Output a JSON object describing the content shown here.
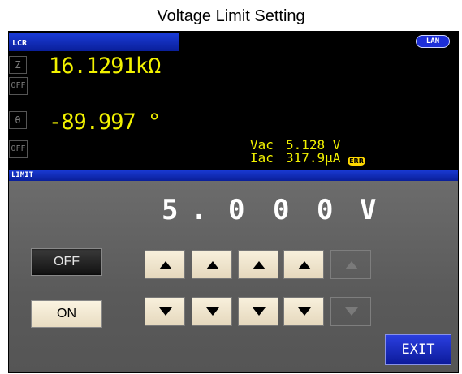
{
  "window": {
    "title": "Voltage Limit Setting"
  },
  "lcr": {
    "tab_label": "LCR",
    "lan_badge": "LAN",
    "params": [
      {
        "label": "Z",
        "value": "16.1291kΩ"
      },
      {
        "label": "OFF"
      },
      {
        "label": "θ",
        "value": "-89.997 °"
      },
      {
        "label": "OFF"
      }
    ],
    "vac_label": "Vac",
    "vac_value": "5.128 V",
    "iac_label": "Iac",
    "iac_value": "317.9μA",
    "err_badge": "ERR"
  },
  "limit": {
    "tab_label": "LIMIT",
    "value_digits": [
      "5",
      ".",
      "0",
      "0",
      "0",
      "V"
    ],
    "off_label": "OFF",
    "on_label": "ON",
    "exit_label": "EXIT",
    "arrow_columns": [
      {
        "enabled": true
      },
      {
        "enabled": true
      },
      {
        "enabled": true
      },
      {
        "enabled": true
      },
      {
        "enabled": false
      }
    ]
  },
  "colors": {
    "measurement_text": "#f2f200",
    "header_blue": "#1a3bd6",
    "button_beige": "#f8f0dc",
    "panel_gray": "#666666"
  }
}
